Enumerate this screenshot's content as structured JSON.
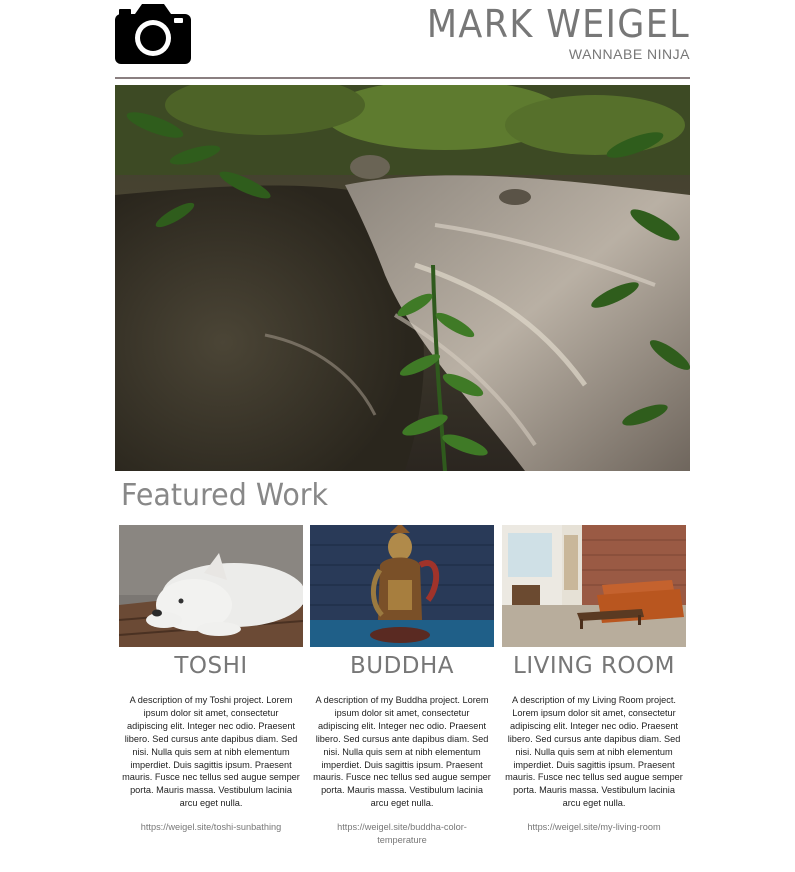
{
  "header": {
    "logo_icon": "camera-icon",
    "site_title": "MARK WEIGEL",
    "site_subtitle": "WANNABE NINJA"
  },
  "hero": {
    "image": "stream-in-forest-photo"
  },
  "featured": {
    "title": "Featured Work",
    "cards": [
      {
        "image": "white-dog-photo",
        "title": "TOSHI",
        "description": "A description of my Toshi project. Lorem ipsum dolor sit amet, consectetur adipiscing elit. Integer nec odio. Praesent libero. Sed cursus ante dapibus diam. Sed nisi. Nulla quis sem at nibh elementum imperdiet. Duis sagittis ipsum. Praesent mauris. Fusce nec tellus sed augue semper porta. Mauris massa. Vestibulum lacinia arcu eget nulla.",
        "link": "https://weigel.site/toshi-sunbathing"
      },
      {
        "image": "buddha-statue-photo",
        "title": "BUDDHA",
        "description": "A description of my Buddha project. Lorem ipsum dolor sit amet, consectetur adipiscing elit. Integer nec odio. Praesent libero. Sed cursus ante dapibus diam. Sed nisi. Nulla quis sem at nibh elementum imperdiet. Duis sagittis ipsum. Praesent mauris. Fusce nec tellus sed augue semper porta. Mauris massa. Vestibulum lacinia arcu eget nulla.",
        "link": "https://weigel.site/buddha-color-temperature"
      },
      {
        "image": "living-room-photo",
        "title": "LIVING ROOM",
        "description": "A description of my Living Room project. Lorem ipsum dolor sit amet, consectetur adipiscing elit. Integer nec odio. Praesent libero. Sed cursus ante dapibus diam. Sed nisi. Nulla quis sem at nibh elementum imperdiet. Duis sagittis ipsum. Praesent mauris. Fusce nec tellus sed augue semper porta. Mauris massa. Vestibulum lacinia arcu eget nulla.",
        "link": "https://weigel.site/my-living-room"
      }
    ]
  }
}
